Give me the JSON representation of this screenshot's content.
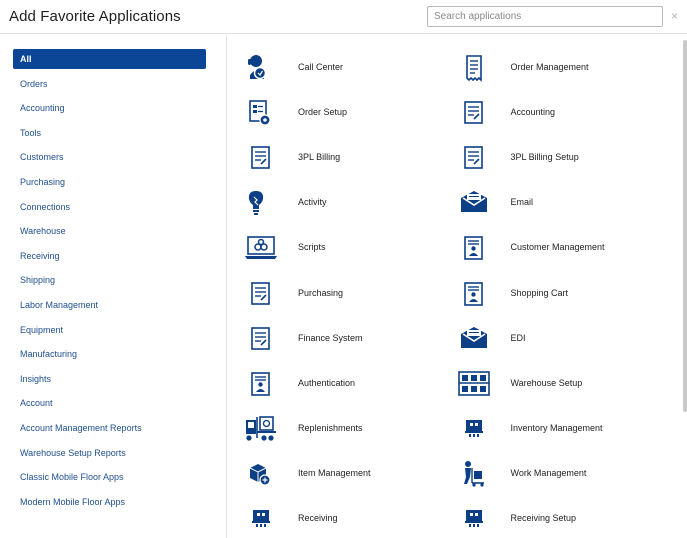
{
  "header": {
    "title": "Add Favorite Applications",
    "search_placeholder": "Search applications",
    "search_value": "",
    "close_glyph": "×"
  },
  "categories": [
    {
      "label": "All",
      "active": true
    },
    {
      "label": "Orders"
    },
    {
      "label": "Accounting"
    },
    {
      "label": "Tools"
    },
    {
      "label": "Customers"
    },
    {
      "label": "Purchasing"
    },
    {
      "label": "Connections"
    },
    {
      "label": "Warehouse"
    },
    {
      "label": "Receiving"
    },
    {
      "label": "Shipping"
    },
    {
      "label": "Labor Management"
    },
    {
      "label": "Equipment"
    },
    {
      "label": "Manufacturing"
    },
    {
      "label": "Insights"
    },
    {
      "label": "Account"
    },
    {
      "label": "Account Management Reports"
    },
    {
      "label": "Warehouse Setup Reports"
    },
    {
      "label": "Classic Mobile Floor Apps"
    },
    {
      "label": "Modern Mobile Floor Apps"
    }
  ],
  "apps": [
    {
      "label": "Call Center",
      "icon": "headset-icon"
    },
    {
      "label": "Order Management",
      "icon": "receipt-icon"
    },
    {
      "label": "Order Setup",
      "icon": "order-setup-icon"
    },
    {
      "label": "Accounting",
      "icon": "document-icon"
    },
    {
      "label": "3PL Billing",
      "icon": "document-icon"
    },
    {
      "label": "3PL Billing Setup",
      "icon": "document-icon"
    },
    {
      "label": "Activity",
      "icon": "lightbulb-icon"
    },
    {
      "label": "Email",
      "icon": "envelope-icon"
    },
    {
      "label": "Scripts",
      "icon": "laptop-gears-icon"
    },
    {
      "label": "Customer Management",
      "icon": "id-card-icon"
    },
    {
      "label": "Purchasing",
      "icon": "document-icon"
    },
    {
      "label": "Shopping Cart",
      "icon": "id-card-icon"
    },
    {
      "label": "Finance System",
      "icon": "document-icon"
    },
    {
      "label": "EDI",
      "icon": "envelope-icon"
    },
    {
      "label": "Authentication",
      "icon": "id-card-icon"
    },
    {
      "label": "Warehouse Setup",
      "icon": "shelving-icon"
    },
    {
      "label": "Replenishments",
      "icon": "forklift-icon"
    },
    {
      "label": "Inventory Management",
      "icon": "inventory-icon"
    },
    {
      "label": "Item Management",
      "icon": "boxes-icon"
    },
    {
      "label": "Work Management",
      "icon": "hand-truck-icon"
    },
    {
      "label": "Receiving",
      "icon": "inventory-icon"
    },
    {
      "label": "Receiving Setup",
      "icon": "inventory-icon"
    }
  ],
  "colors": {
    "accent": "#0b4595",
    "link": "#1e4f8f",
    "icon": "#0d3f86"
  }
}
